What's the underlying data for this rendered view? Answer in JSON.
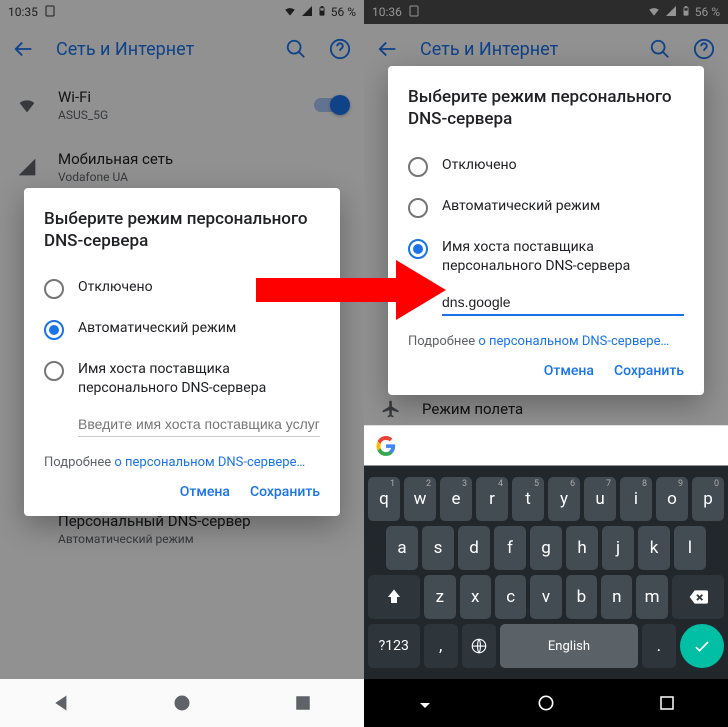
{
  "status": {
    "time_left": "10:35",
    "time_right": "10:36",
    "battery": "56 %"
  },
  "appbar": {
    "title": "Сеть и Интернет"
  },
  "settings": {
    "wifi": {
      "title": "Wi-Fi",
      "sub": "ASUS_5G"
    },
    "mobile": {
      "title": "Мобильная сеть",
      "sub": "Vodafone UA"
    },
    "dns": {
      "title": "Персональный DNS-сервер",
      "sub": "Автоматический режим"
    },
    "airplane": {
      "title": "Режим полета"
    }
  },
  "dialog": {
    "title": "Выберите режим персонального DNS-сервера",
    "opt_off": "Отключено",
    "opt_auto": "Автоматический режим",
    "opt_host": "Имя хоста поставщика персонального DNS-сервера",
    "placeholder": "Введите имя хоста поставщика услуг DNS",
    "input_value": "dns.google",
    "hint_pre": "Подробнее ",
    "hint_link": "о персональном DNS-сервере…",
    "cancel": "Отмена",
    "save": "Сохранить"
  },
  "keyboard": {
    "row1": [
      "q",
      "w",
      "e",
      "r",
      "t",
      "y",
      "u",
      "i",
      "o",
      "p"
    ],
    "sup1": [
      "1",
      "2",
      "3",
      "4",
      "5",
      "6",
      "7",
      "8",
      "9",
      "0"
    ],
    "row2": [
      "a",
      "s",
      "d",
      "f",
      "g",
      "h",
      "j",
      "k",
      "l"
    ],
    "row3": [
      "z",
      "x",
      "c",
      "v",
      "b",
      "n",
      "m"
    ],
    "sym": "?123",
    "space": "English"
  }
}
